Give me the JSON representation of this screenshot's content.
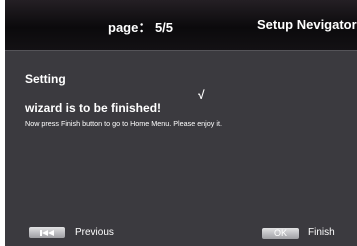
{
  "header": {
    "page_indicator": "page： 5/5",
    "title": "Setup Nevigator"
  },
  "content": {
    "section_title": "Setting",
    "check_mark": "√",
    "heading": "wizard is to be finished!",
    "message": "Now press Finish button to go to Home Menu. Please enjoy it."
  },
  "footer": {
    "previous": {
      "key_icon": "skip-back-icon",
      "label": "Previous"
    },
    "finish": {
      "key_label": "OK",
      "label": "Finish"
    }
  },
  "colors": {
    "header_bg": "#0b0a0c",
    "panel_bg": "#3b3a3f",
    "text": "#ffffff",
    "key_button": "#c4c4c7"
  }
}
